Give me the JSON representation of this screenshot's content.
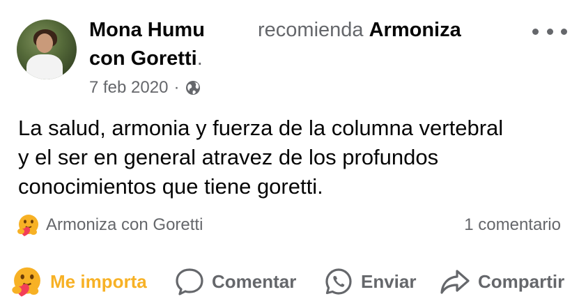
{
  "post": {
    "author": "Mona Humu",
    "with_prefix": "con",
    "tagged_person": "Goretti",
    "period": ".",
    "recommends_label": "recomienda",
    "recommended_page": "Armoniza",
    "date": "7 feb 2020",
    "separator": "·",
    "privacy_icon": "globe-icon",
    "body_text": "La salud,  armonia y fuerza de la columna vertebral\ny el ser  en general atravez de los profundos\nconocimientos que tiene goretti."
  },
  "reactions": {
    "icon": "care-emoji-icon",
    "summary": "Armoniza con Goretti",
    "comment_count": "1 comentario"
  },
  "actions": {
    "react_label": "Me importa",
    "comment_label": "Comentar",
    "send_label": "Enviar",
    "share_label": "Compartir"
  },
  "colors": {
    "text_primary": "#050505",
    "text_secondary": "#65676b",
    "reaction_yellow": "#f7b125",
    "heart_red": "#f33e58"
  }
}
